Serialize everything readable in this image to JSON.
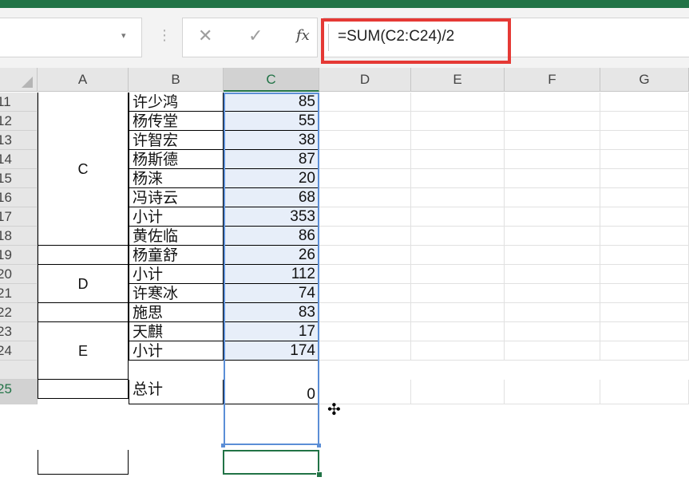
{
  "formula_bar": {
    "namebox_value": "",
    "formula": "=SUM(C2:C24)/2",
    "cancel_glyph": "✕",
    "enter_glyph": "✓",
    "fx_label": "fx"
  },
  "columns": [
    "A",
    "B",
    "C",
    "D",
    "E",
    "F",
    "G"
  ],
  "rows": [
    {
      "num": "11",
      "b": "许少鸿",
      "c": "85"
    },
    {
      "num": "12",
      "b": "杨传堂",
      "c": "55"
    },
    {
      "num": "13",
      "b": "许智宏",
      "c": "38"
    },
    {
      "num": "14",
      "b": "杨斯德",
      "c": "87"
    },
    {
      "num": "15",
      "b": "杨涞",
      "c": "20"
    },
    {
      "num": "16",
      "b": "冯诗云",
      "c": "68"
    },
    {
      "num": "17",
      "b": "小计",
      "c": "353"
    },
    {
      "num": "18",
      "b": "黄佐临",
      "c": "86"
    },
    {
      "num": "19",
      "b": "杨童舒",
      "c": "26"
    },
    {
      "num": "20",
      "b": "小计",
      "c": "112"
    },
    {
      "num": "21",
      "b": "许寒冰",
      "c": "74"
    },
    {
      "num": "22",
      "b": "施思",
      "c": "83"
    },
    {
      "num": "23",
      "b": "天麒",
      "c": "17"
    },
    {
      "num": "24",
      "b": "小计",
      "c": "174"
    },
    {
      "num": "25",
      "b": "总计",
      "c": "0"
    }
  ],
  "groups": {
    "c": "C",
    "d": "D",
    "e": "E"
  },
  "active_row": "25"
}
